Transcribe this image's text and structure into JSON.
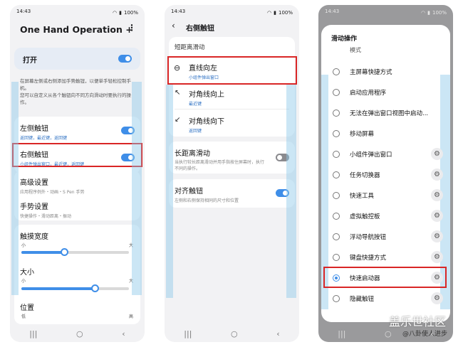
{
  "status": {
    "time": "14:43",
    "battery": "100%"
  },
  "phone1": {
    "title": "One Hand Operation +",
    "master_label": "打开",
    "description1": "在屏幕左侧或右侧添加手势触钮，以便单手轻松控制手机。",
    "description2": "您可以自定义从各个触钮向不同方向滑动时要执行的操作。",
    "left_handle": {
      "title": "左侧触钮",
      "sub": "返回键，最近键，返回键"
    },
    "right_handle": {
      "title": "右侧触钮",
      "sub": "小组件弹出窗口，最近键，返回键"
    },
    "advanced": {
      "title": "高级设置",
      "sub": "应用程序例外・动画・S Pen 手势"
    },
    "gesture": {
      "title": "手势设置",
      "sub": "快捷操作・滑动距离・振动"
    },
    "width": {
      "title": "触摸宽度",
      "min": "小",
      "max": "大",
      "value": 0.4
    },
    "size": {
      "title": "大小",
      "min": "小",
      "max": "大",
      "value": 0.68
    },
    "position": {
      "title": "位置",
      "min": "低",
      "max": "高"
    }
  },
  "phone2": {
    "header": "右侧触钮",
    "section": "短距离滑动",
    "items": [
      {
        "title": "直线向左",
        "sub": "小组件弹出窗口"
      },
      {
        "title": "对角线向上",
        "sub": "最近键"
      },
      {
        "title": "对角线向下",
        "sub": "返回键"
      }
    ],
    "long": {
      "title": "长距离滑动",
      "sub": "当执行较长距离滑动并用手指按住屏幕时，执行不同的操作。"
    },
    "align": {
      "title": "对齐触钮",
      "sub": "左侧和右侧保持相同的尺寸和位置"
    }
  },
  "phone3": {
    "dialog_title": "滑动操作",
    "partial": "模式",
    "options": [
      {
        "label": "主屏幕快捷方式",
        "gear": false,
        "selected": false
      },
      {
        "label": "启动应用程序",
        "gear": false,
        "selected": false
      },
      {
        "label": "无法在弹出窗口视图中启动...",
        "gear": false,
        "selected": false
      },
      {
        "label": "移动屏幕",
        "gear": false,
        "selected": false
      },
      {
        "label": "小组件弹出窗口",
        "gear": true,
        "selected": false
      },
      {
        "label": "任务切换器",
        "gear": true,
        "selected": false
      },
      {
        "label": "快速工具",
        "gear": true,
        "selected": false
      },
      {
        "label": "虚拟触控板",
        "gear": true,
        "selected": false
      },
      {
        "label": "浮动导航按钮",
        "gear": true,
        "selected": false
      },
      {
        "label": "键盘快捷方式",
        "gear": true,
        "selected": false
      },
      {
        "label": "快速启动器",
        "gear": true,
        "selected": true
      },
      {
        "label": "隐藏触钮",
        "gear": true,
        "selected": false
      }
    ],
    "watermark": "盖乐世社区",
    "watermark2": "@八卦使人进步"
  },
  "colors": {
    "accent": "#3f8ee8",
    "highlight": "#d92626",
    "subtext_blue": "#2f72c4"
  }
}
